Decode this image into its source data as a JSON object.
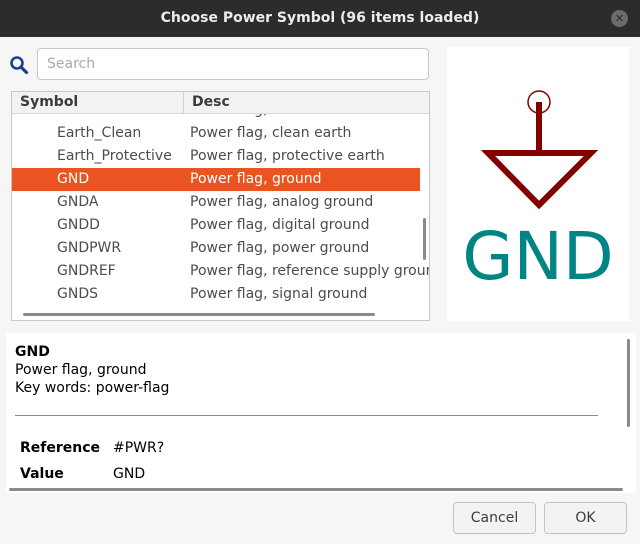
{
  "window": {
    "title": "Choose Power Symbol (96 items loaded)"
  },
  "search": {
    "placeholder": "Search",
    "value": ""
  },
  "table": {
    "columns": [
      "Symbol",
      "Desc"
    ],
    "rows": [
      {
        "symbol": "Earth",
        "desc": "Power flag, earth"
      },
      {
        "symbol": "Earth_Clean",
        "desc": "Power flag, clean earth"
      },
      {
        "symbol": "Earth_Protective",
        "desc": "Power flag, protective earth"
      },
      {
        "symbol": "GND",
        "desc": "Power flag, ground"
      },
      {
        "symbol": "GNDA",
        "desc": "Power flag, analog ground"
      },
      {
        "symbol": "GNDD",
        "desc": "Power flag, digital ground"
      },
      {
        "symbol": "GNDPWR",
        "desc": "Power flag, power ground"
      },
      {
        "symbol": "GNDREF",
        "desc": "Power flag, reference supply ground"
      },
      {
        "symbol": "GNDS",
        "desc": "Power flag, signal ground"
      }
    ],
    "selected_index": 3
  },
  "preview": {
    "symbol_text": "GND",
    "colors": {
      "body": "#840000",
      "text": "#008484",
      "pin": "#840000"
    }
  },
  "details": {
    "name": "GND",
    "description": "Power flag, ground",
    "keywords": "Key words: power-flag",
    "fields": [
      {
        "label": "Reference",
        "value": "#PWR?"
      },
      {
        "label": "Value",
        "value": "GND"
      }
    ]
  },
  "buttons": {
    "cancel": "Cancel",
    "ok": "OK"
  },
  "colors": {
    "selection": "#e95420",
    "titlebar": "#2c2c2c"
  }
}
